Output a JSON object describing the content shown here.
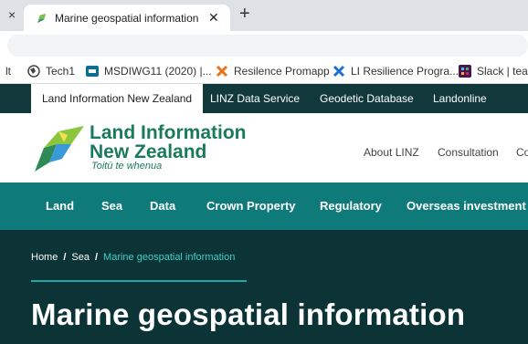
{
  "browser": {
    "tab_left_close": "×",
    "active_tab_title": "Marine geospatial information | L",
    "active_tab_close": "✕",
    "new_tab": "+"
  },
  "bookmarks": [
    {
      "label": "lt",
      "icon": "partial-bookmark"
    },
    {
      "label": "Tech1",
      "icon": "globe-icon"
    },
    {
      "label": "MSDIWG11 (2020) |...",
      "icon": "video-icon"
    },
    {
      "label": "Resilence Promapp",
      "icon": "promapp-icon"
    },
    {
      "label": "LI Resilience Progra...",
      "icon": "promapp-blue-icon"
    },
    {
      "label": "Slack | team",
      "icon": "slack-icon"
    }
  ],
  "site_nav": {
    "items": [
      "Land Information New Zealand",
      "LINZ Data Service",
      "Geodetic Database",
      "Landonline"
    ]
  },
  "header": {
    "logo_line1": "Land Information",
    "logo_line2": "New Zealand",
    "logo_tagline": "Toitū te whenua",
    "links": [
      "About LINZ",
      "Consultation",
      "Co"
    ]
  },
  "main_nav": {
    "items": [
      "Land",
      "Sea",
      "Data",
      "Crown Property",
      "Regulatory",
      "Overseas investment"
    ]
  },
  "breadcrumb": {
    "home": "Home",
    "sep": "/",
    "section": "Sea",
    "current": "Marine geospatial information"
  },
  "page": {
    "title": "Marine geospatial information"
  },
  "colors": {
    "site_nav_bg": "#11383b",
    "main_nav_bg": "#0f7a7a",
    "hero_bg": "#0c3335",
    "logo_green": "#1a7b5c",
    "breadcrumb_accent": "#3fd0c8"
  }
}
